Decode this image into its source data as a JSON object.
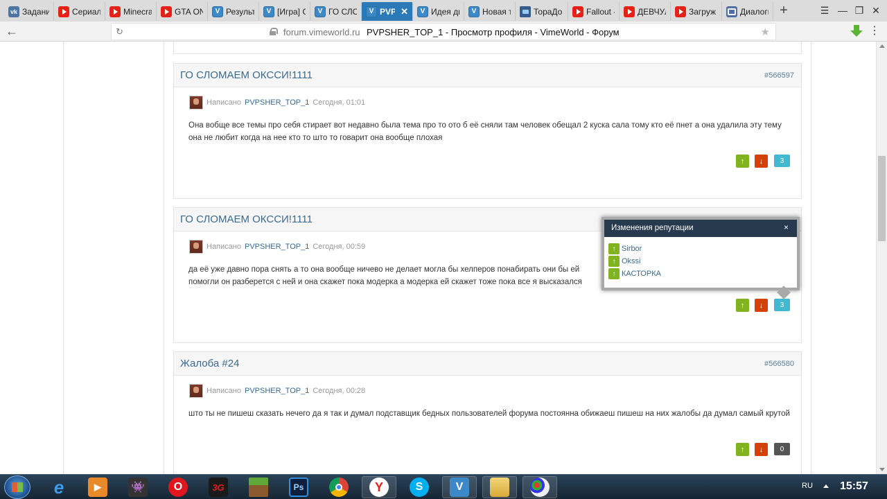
{
  "tabs": [
    {
      "label": "Задания",
      "icon": "vk-icon"
    },
    {
      "label": "Сериал",
      "icon": "youtube-icon"
    },
    {
      "label": "Minecraft",
      "icon": "youtube-icon"
    },
    {
      "label": "GTA ON",
      "icon": "youtube-icon"
    },
    {
      "label": "Результ",
      "icon": "vimeworld-icon"
    },
    {
      "label": "[Игра] С",
      "icon": "vimeworld-icon"
    },
    {
      "label": "ГО СЛОМ",
      "icon": "vimeworld-icon"
    },
    {
      "label": "PVPS",
      "icon": "vimeworld-icon",
      "active": true
    },
    {
      "label": "Идея ди",
      "icon": "vimeworld-icon"
    },
    {
      "label": "Новая т",
      "icon": "vimeworld-icon"
    },
    {
      "label": "ТораДо",
      "icon": "toradora-icon"
    },
    {
      "label": "Fallout -",
      "icon": "youtube-icon"
    },
    {
      "label": "ДЕВЧУЛ",
      "icon": "youtube-icon"
    },
    {
      "label": "Загруж",
      "icon": "youtube-icon"
    },
    {
      "label": "Диалоги",
      "icon": "dialog-icon"
    }
  ],
  "address": {
    "domain": "forum.vimeworld.ru",
    "title": "PVPSHER_TOP_1 - Просмотр профиля - VimeWorld - Форум"
  },
  "posts": [
    {
      "title": "ГО СЛОМАЕМ ОКССИ!1111",
      "id": "#566597",
      "written": "Написано",
      "author": "PVPSHER_TOP_1",
      "date": "Сегодня, 01:01",
      "text": "Она вобще все темы про себя стирает вот недавно была тема про то ото б её сняли там человек обещал 2 куска сала тому кто её пнет а она удалила эту тему она не любит когда на нее кто то што то говарит она вообще плохая",
      "rep": "3"
    },
    {
      "title": "ГО СЛОМАЕМ ОКССИ!1111",
      "id": "",
      "written": "Написано",
      "author": "PVPSHER_TOP_1",
      "date": "Сегодня, 00:59",
      "text": "да её уже давно пора снять а то она вообще ничево не делает могла бы хелперов понабирать они бы ей помогли он разберется с ней и она скажет пока модерка а модерка ей скажет тоже пока все я высказался",
      "rep": "3"
    },
    {
      "title": "Жалоба #24",
      "id": "#566580",
      "written": "Написано",
      "author": "PVPSHER_TOP_1",
      "date": "Сегодня, 00:28",
      "text": "што ты не пишеш сказать нечего да я так и думал подставщик бедных пользователей форума постоянна обижаеш пишеш на них жалобы да думал самый крутой",
      "rep": "0"
    }
  ],
  "popup": {
    "title": "Изменения репутации",
    "close": "×",
    "users": [
      "Sirbor",
      "Okssi",
      "КАСТОРКА"
    ]
  },
  "taskbar": {
    "lang": "RU",
    "clock": "15:57",
    "apps": [
      "ie-icon",
      "media-player-icon",
      "game-icon",
      "opera-icon",
      "3g-icon",
      "minecraft-icon",
      "photoshop-icon",
      "chrome-icon",
      "yandex-browser-icon",
      "skype-icon",
      "vimeworld-icon",
      "explorer-icon",
      "paint-icon"
    ]
  },
  "colors": {
    "accent": "#2b79b6",
    "link": "#3a6a8e",
    "rep_up": "#7fb31f",
    "rep_down": "#d3420b",
    "rep_count": "#43b8d1"
  }
}
